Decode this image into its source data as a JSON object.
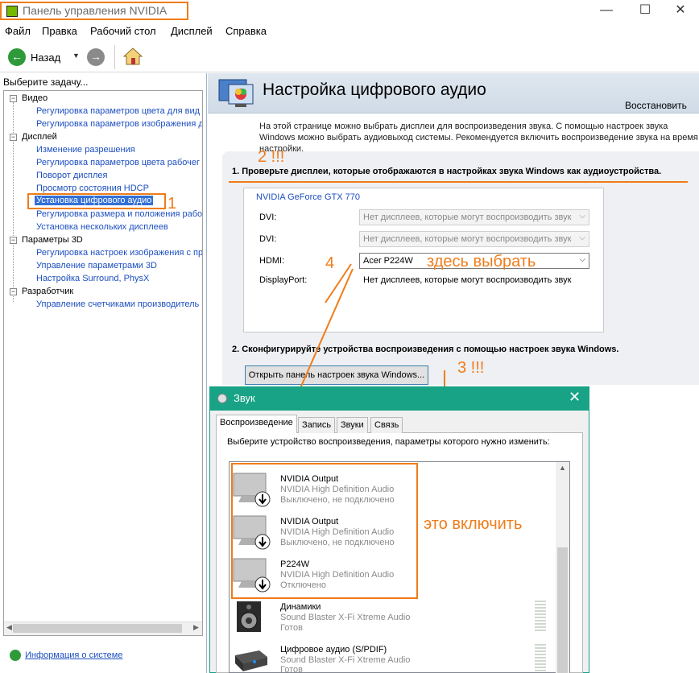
{
  "window": {
    "title": "Панель управления NVIDIA",
    "minimize": "—",
    "maximize": "☐",
    "close": "✕"
  },
  "menu": [
    "Файл",
    "Правка",
    "Рабочий стол",
    "Дисплей",
    "Справка"
  ],
  "toolbar": {
    "back_label": "Назад"
  },
  "sidebar": {
    "task_label": "Выберите задачу...",
    "categories": [
      {
        "label": "Видео",
        "items": [
          "Регулировка параметров цвета для вид",
          "Регулировка параметров изображения д"
        ]
      },
      {
        "label": "Дисплей",
        "items": [
          "Изменение разрешения",
          "Регулировка параметров цвета рабочег",
          "Поворот дисплея",
          "Просмотр состояния HDCP",
          "Установка цифрового аудио",
          "Регулировка размера и положения рабо",
          "Установка нескольких дисплеев"
        ]
      },
      {
        "label": "Параметры 3D",
        "items": [
          "Регулировка настроек изображения с пр",
          "Управление параметрами 3D",
          "Настройка Surround, PhysX"
        ]
      },
      {
        "label": "Разработчик",
        "items": [
          "Управление счетчиками производитель"
        ]
      }
    ],
    "selected_item": "Установка цифрового аудио",
    "system_info": "Информация о системе"
  },
  "main": {
    "title": "Настройка цифрового аудио",
    "restore": "Восстановить",
    "intro": "На этой странице можно выбрать дисплеи для воспроизведения звука. С помощью настроек звука Windows можно выбрать аудиовыход системы. Рекомендуется включить воспроизведение звука на время настройки.",
    "step1": "1. Проверьте дисплеи, которые отображаются в настройках звука Windows как аудиоустройства.",
    "gpu": "NVIDIA GeForce GTX 770",
    "displays": [
      {
        "label": "DVI:",
        "value": "Нет дисплеев, которые могут воспроизводить звук",
        "enabled": false
      },
      {
        "label": "DVI:",
        "value": "Нет дисплеев, которые могут воспроизводить звук",
        "enabled": false
      },
      {
        "label": "HDMI:",
        "value": "Acer P224W",
        "enabled": true
      },
      {
        "label": "DisplayPort:",
        "value": "Нет дисплеев, которые могут воспроизводить звук",
        "enabled": null
      }
    ],
    "step2": "2. Сконфигурируйте устройства воспроизведения с помощью настроек звука Windows.",
    "open_button": "Открыть панель настроек звука Windows..."
  },
  "annotations": {
    "a1": "1",
    "a2": "2 !!!",
    "a3": "3 !!!",
    "a4": "4",
    "select_here": "здесь выбрать",
    "enable_this": "это включить"
  },
  "sound_dialog": {
    "title": "Звук",
    "tabs": [
      "Воспроизведение",
      "Запись",
      "Звуки",
      "Связь"
    ],
    "description": "Выберите устройство воспроизведения, параметры которого нужно изменить:",
    "devices": [
      {
        "name": "NVIDIA Output",
        "driver": "NVIDIA High Definition Audio",
        "status": "Выключено, не подключено",
        "icon": "monitor-icon"
      },
      {
        "name": "NVIDIA Output",
        "driver": "NVIDIA High Definition Audio",
        "status": "Выключено, не подключено",
        "icon": "monitor-icon"
      },
      {
        "name": "P224W",
        "driver": "NVIDIA High Definition Audio",
        "status": "Отключено",
        "icon": "monitor-icon"
      },
      {
        "name": "Динамики",
        "driver": "Sound Blaster X-Fi Xtreme Audio",
        "status": "Готов",
        "icon": "speaker-icon"
      },
      {
        "name": "Цифровое аудио (S/PDIF)",
        "driver": "Sound Blaster X-Fi Xtreme Audio",
        "status": "Готов",
        "icon": "spdif-icon"
      }
    ]
  },
  "colors": {
    "annotation": "#f07c1a",
    "dialog_title": "#18a386",
    "link": "#1d4fc0",
    "nvidia_green": "#76b900"
  }
}
